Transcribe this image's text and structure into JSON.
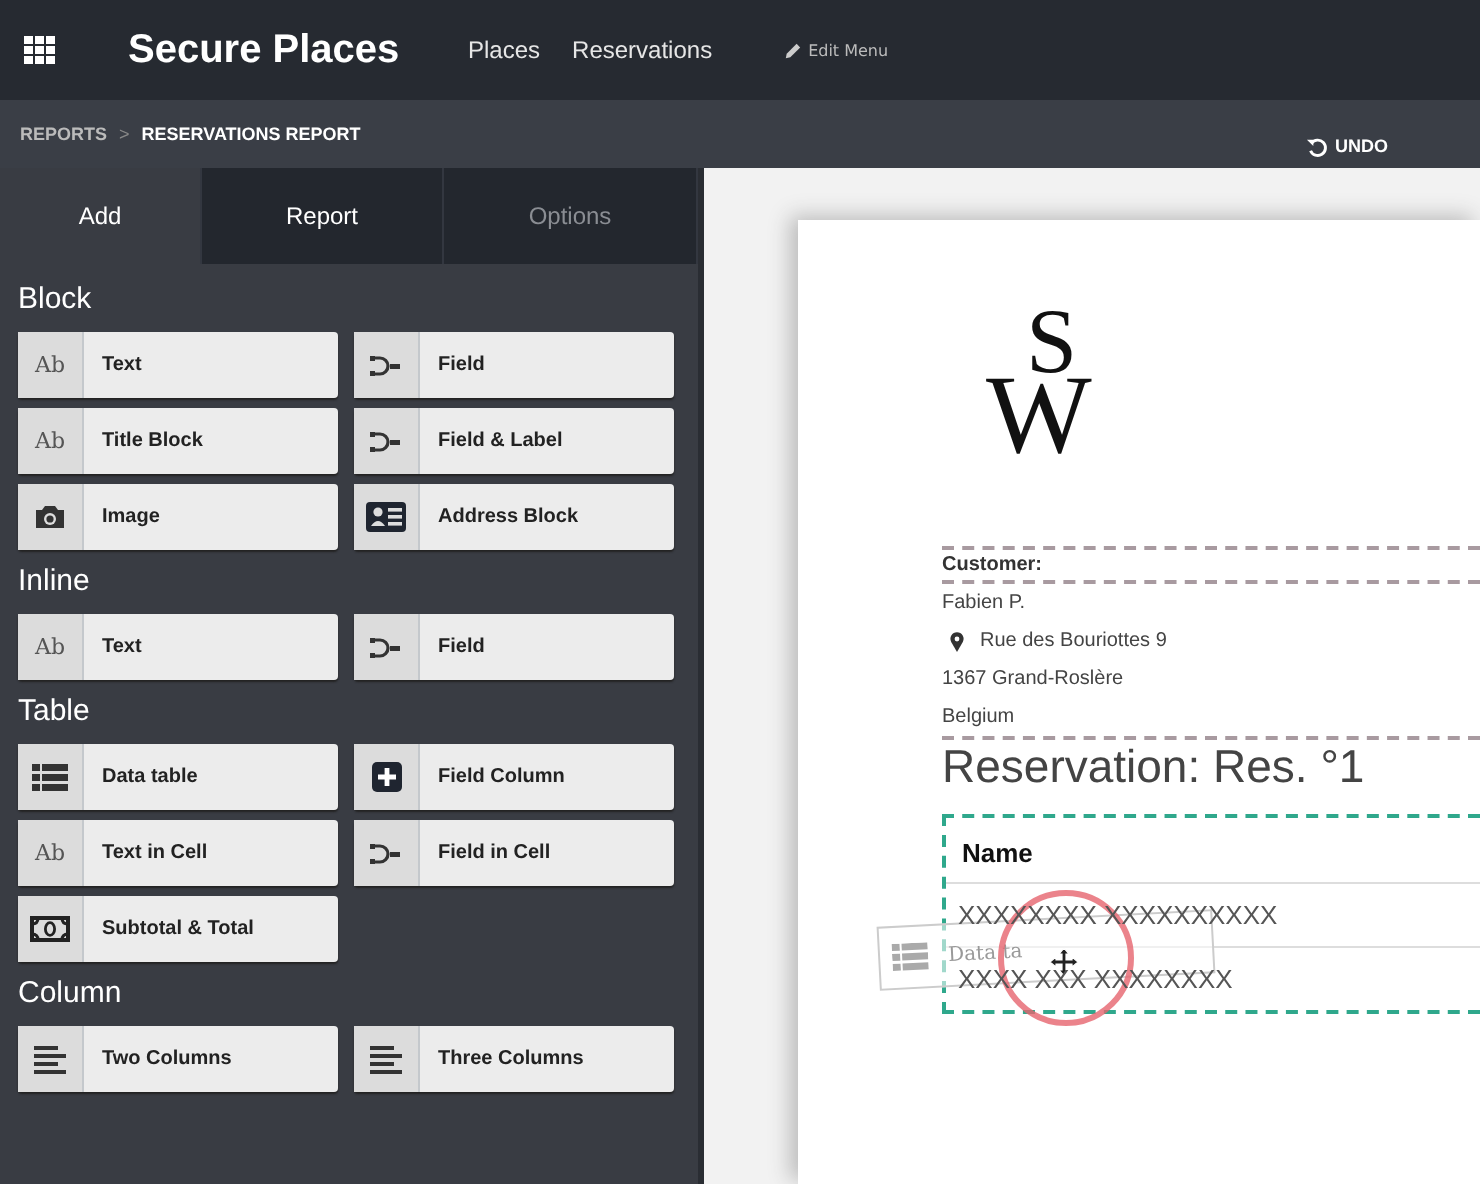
{
  "topbar": {
    "app_title": "Secure Places",
    "nav": [
      "Places",
      "Reservations"
    ],
    "edit_menu": "Edit Menu"
  },
  "breadcrumb": {
    "items": [
      "REPORTS",
      "RESERVATIONS REPORT"
    ],
    "separator": ">",
    "undo": "UNDO"
  },
  "tabs": [
    {
      "label": "Add",
      "selected": true,
      "disabled": false
    },
    {
      "label": "Report",
      "selected": false,
      "disabled": false
    },
    {
      "label": "Options",
      "selected": false,
      "disabled": true
    }
  ],
  "sections": [
    {
      "title": "Block",
      "items": [
        {
          "label": "Text",
          "kind": "text",
          "glyph": "Ab"
        },
        {
          "label": "Field",
          "kind": "field"
        },
        {
          "label": "Title Block",
          "kind": "text",
          "glyph": "Ab"
        },
        {
          "label": "Field & Label",
          "kind": "field"
        },
        {
          "label": "Image",
          "kind": "image"
        },
        {
          "label": "Address Block",
          "kind": "address"
        }
      ]
    },
    {
      "title": "Inline",
      "items": [
        {
          "label": "Text",
          "kind": "text",
          "glyph": "Ab"
        },
        {
          "label": "Field",
          "kind": "field"
        }
      ]
    },
    {
      "title": "Table",
      "items": [
        {
          "label": "Data table",
          "kind": "table"
        },
        {
          "label": "Field Column",
          "kind": "plus"
        },
        {
          "label": "Text in Cell",
          "kind": "text",
          "glyph": "Ab"
        },
        {
          "label": "Field in Cell",
          "kind": "field"
        },
        {
          "label": "Subtotal & Total",
          "kind": "money"
        }
      ]
    },
    {
      "title": "Column",
      "items": [
        {
          "label": "Two Columns",
          "kind": "columns"
        },
        {
          "label": "Three Columns",
          "kind": "columns"
        }
      ]
    }
  ],
  "report": {
    "logo": [
      "S",
      "W"
    ],
    "customer_label": "Customer:",
    "address": [
      {
        "text": "Fabien P.",
        "pin": false
      },
      {
        "text": "Rue des Bouriottes 9",
        "pin": true
      },
      {
        "text": "1367 Grand-Roslère",
        "pin": false
      },
      {
        "text": "Belgium",
        "pin": false
      }
    ],
    "title": "Reservation: Res. °1",
    "table": {
      "header": "Name",
      "rows": [
        "XXXXXXXX XXXXXXXXXX",
        "XXXX XXX XXXXXXXX"
      ]
    }
  },
  "drag_ghost": {
    "label": "Data ta"
  }
}
